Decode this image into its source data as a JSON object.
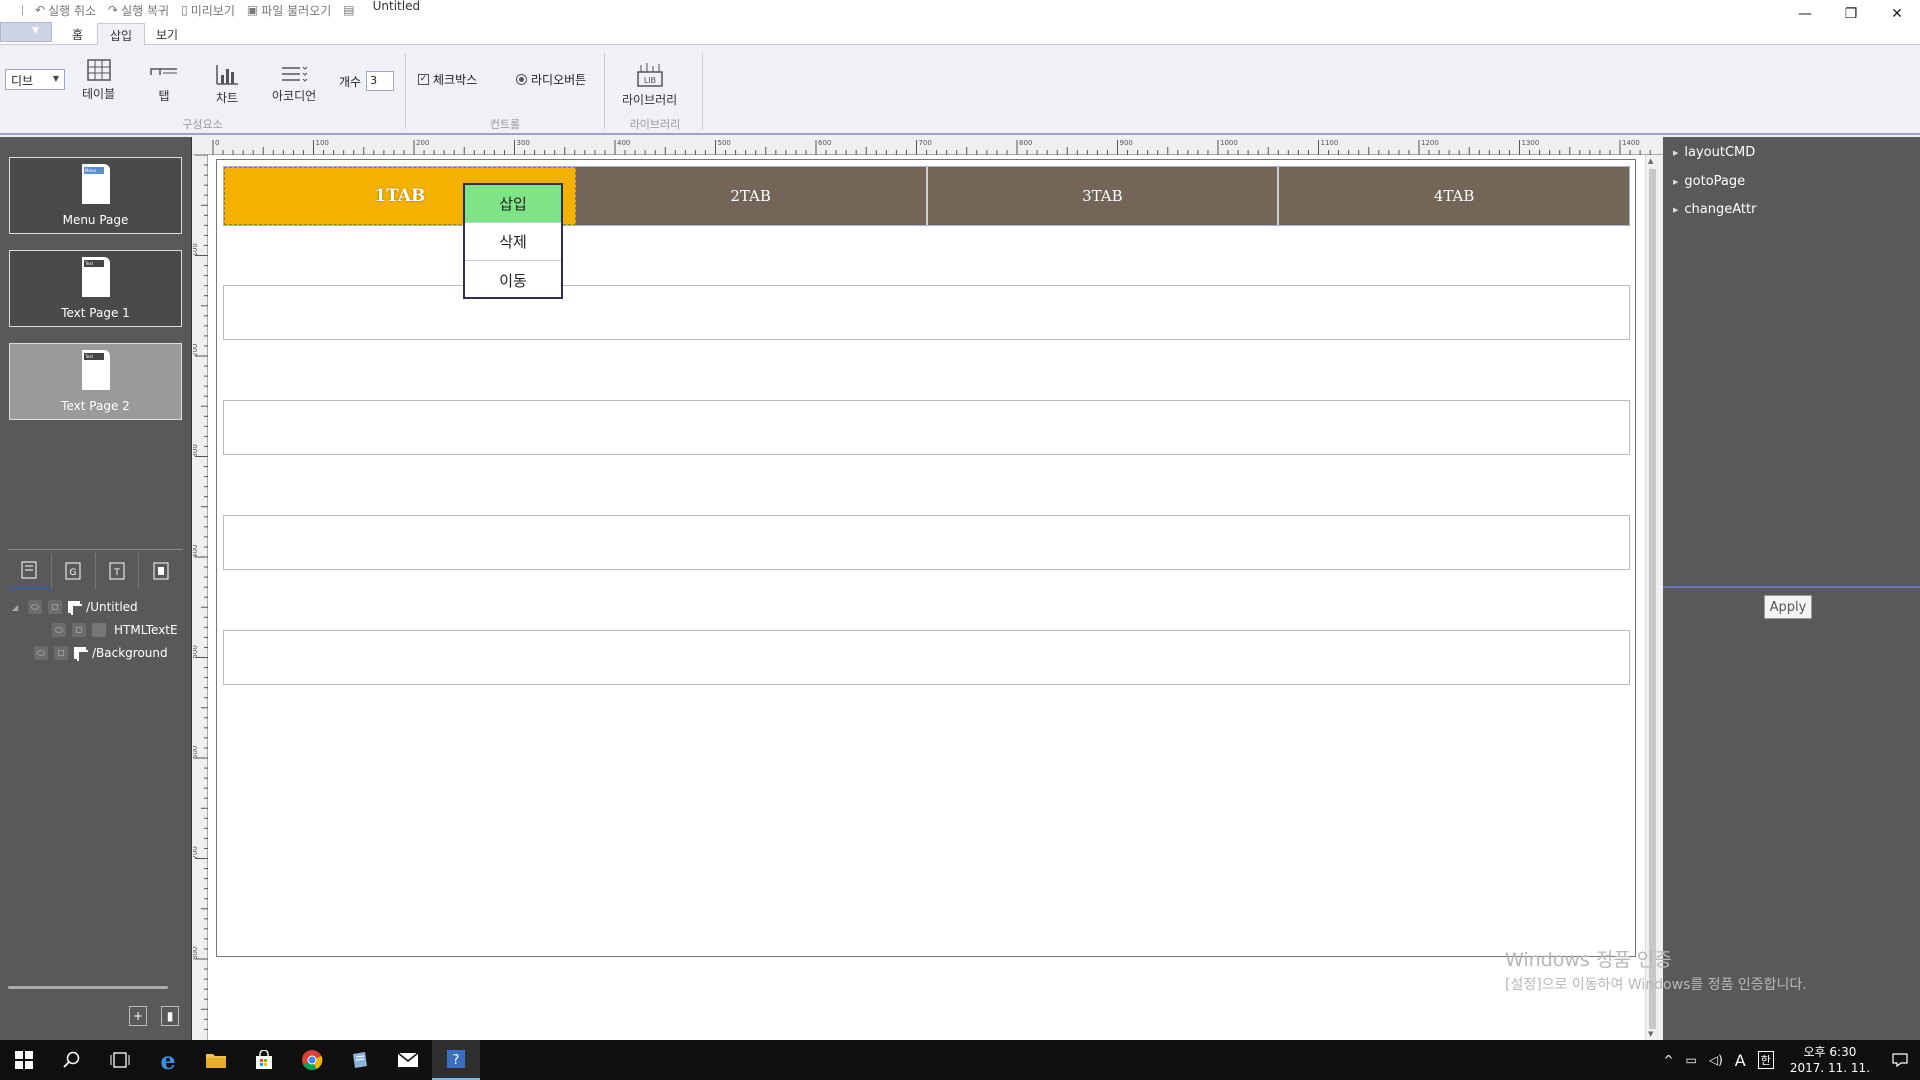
{
  "titlebar": {
    "undo_label": "실행 취소",
    "redo_label": "실행 복귀",
    "preview_label": "미리보기",
    "open_file_label": "파일 불러오기",
    "doc_title": "Untitled"
  },
  "ribbon_tabs": [
    "홈",
    "삽입",
    "보기"
  ],
  "ribbon": {
    "combo_value": "디브",
    "table_label": "테이블",
    "tab_label": "탭",
    "chart_label": "차트",
    "accordion_label": "아코디언",
    "count_label": "개수",
    "count_value": "3",
    "group_components": "구성요소",
    "checkbox_label": "체크박스",
    "radio_label": "라디오버튼",
    "group_controls": "컨트롤",
    "library_label": "라이브러리",
    "library_icon_text": "LIB",
    "group_library": "라이브러리"
  },
  "pages": [
    {
      "label": "Menu Page",
      "tag": "Menu"
    },
    {
      "label": "Text Page 1",
      "tag": "Text"
    },
    {
      "label": "Text Page 2",
      "tag": "Text"
    }
  ],
  "layers": [
    {
      "label": "/Untitled"
    },
    {
      "label": "HTMLTextE"
    },
    {
      "label": "/Background"
    }
  ],
  "panel_tab_icons": [
    "page-tab",
    "group-tab",
    "text-tab",
    "delete-tab"
  ],
  "ruler": {
    "top_ticks": [
      "0",
      "100",
      "200",
      "300",
      "400",
      "500",
      "600",
      "700",
      "800",
      "900",
      "1000",
      "1100",
      "1200",
      "1300",
      "1400"
    ],
    "left_ticks": [
      "100",
      "200",
      "300",
      "400",
      "500",
      "600",
      "700",
      "800"
    ]
  },
  "canvas": {
    "tabs": [
      "1TAB",
      "2TAB",
      "3TAB",
      "4TAB"
    ],
    "active_tab_color": "#f5b100",
    "tab_color": "#736658",
    "context_menu": [
      "삽입",
      "삭제",
      "이동"
    ],
    "context_highlight_color": "#7fe387"
  },
  "right_panel": {
    "commands": [
      "layoutCMD",
      "gotoPage",
      "changeAttr"
    ],
    "apply_label": "Apply"
  },
  "watermark": {
    "line1": "Windows 정품 인증",
    "line2": "[설정]으로 이동하여 Windows를 정품 인증합니다."
  },
  "taskbar": {
    "apps": [
      "windows-start",
      "search",
      "task-view",
      "edge",
      "file-explorer",
      "store",
      "chrome",
      "notepad",
      "mail",
      "app-active"
    ],
    "ime_label": "A",
    "ime_mode": "한",
    "time": "오후 6:30",
    "date": "2017. 11. 11."
  }
}
